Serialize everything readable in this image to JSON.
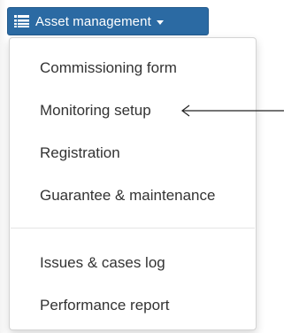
{
  "dropdown": {
    "label": "Asset management",
    "icon": "list-icon",
    "caret_icon": "caret-down-icon",
    "accent_color": "#2b6aa3"
  },
  "menu": {
    "items": [
      {
        "label": "Commissioning form"
      },
      {
        "label": "Monitoring setup"
      },
      {
        "label": "Registration"
      },
      {
        "label": "Guarantee & maintenance"
      },
      {
        "label": "Issues & cases log"
      },
      {
        "label": "Performance report"
      }
    ]
  },
  "annotation": {
    "icon": "arrow-left-icon",
    "points_to": "Monitoring setup"
  }
}
